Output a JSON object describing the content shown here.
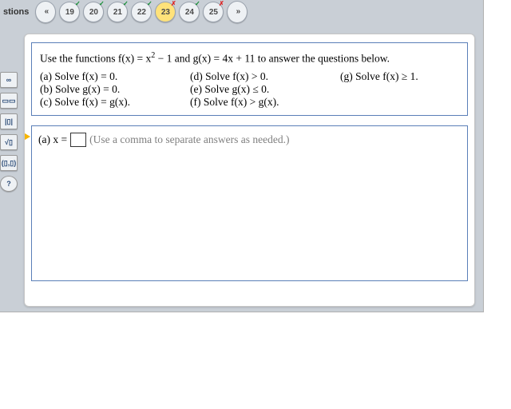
{
  "header": {
    "label": "stions"
  },
  "nav": {
    "prev_glyph": "«",
    "next_glyph": "»"
  },
  "questions": [
    {
      "n": "19",
      "status": "tick"
    },
    {
      "n": "20",
      "status": "tick"
    },
    {
      "n": "21",
      "status": "tick"
    },
    {
      "n": "22",
      "status": "tick"
    },
    {
      "n": "23",
      "status": "cross",
      "current": true
    },
    {
      "n": "24",
      "status": "tick"
    },
    {
      "n": "25",
      "status": "cross"
    }
  ],
  "tools": {
    "inf": "∞",
    "frac": "▭▭",
    "abs": "|▯|",
    "sqrt": "√▯",
    "interval": "(▯,▯)",
    "help": "?"
  },
  "problem": {
    "intro_pre": "Use the functions f(x) = x",
    "intro_exp": "2",
    "intro_mid": " − 1 and g(x) = 4x + 11 to answer the questions below.",
    "a": "(a) Solve f(x) = 0.",
    "b": "(b) Solve g(x) = 0.",
    "c": "(c) Solve f(x) = g(x).",
    "d": "(d) Solve f(x) > 0.",
    "e": "(e) Solve g(x) ≤ 0.",
    "f": "(f) Solve f(x) > g(x).",
    "g": "(g) Solve f(x) ≥ 1."
  },
  "answer": {
    "label": "(a) x =",
    "value": "",
    "hint": "(Use a comma to separate answers as needed.)"
  }
}
